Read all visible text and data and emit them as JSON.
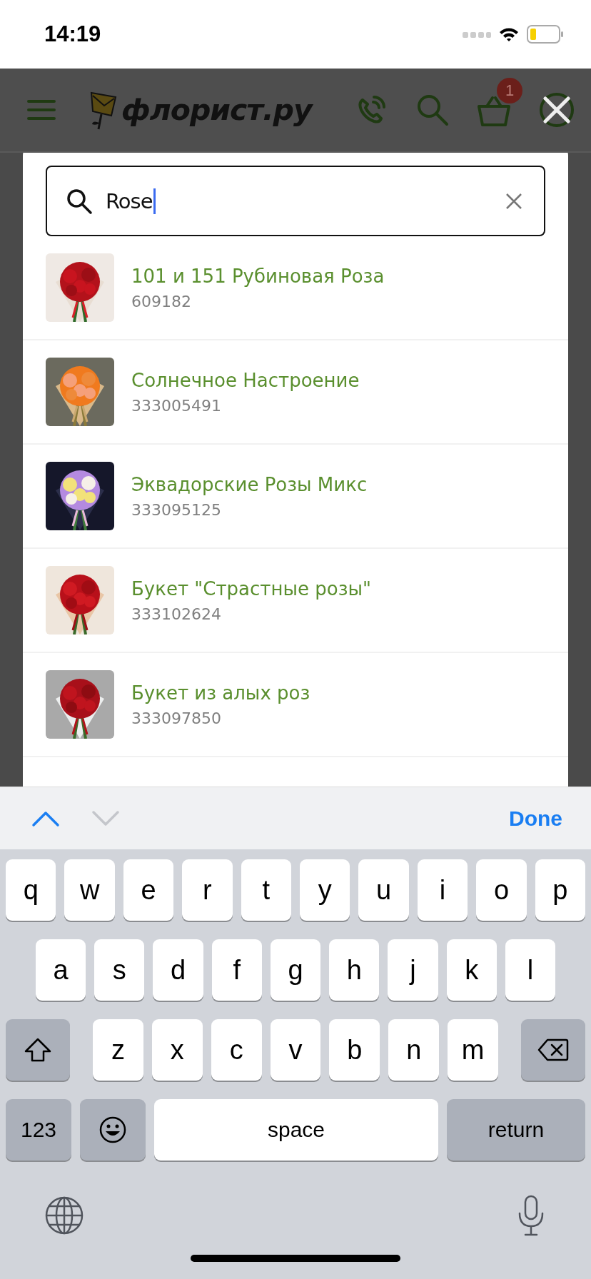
{
  "status_bar": {
    "time": "14:19"
  },
  "header": {
    "logo": "флорист.ру",
    "cart_badge": "1"
  },
  "search": {
    "value": "Rose"
  },
  "results": [
    {
      "title": "101 и 151 Рубиновая Роза",
      "code": "609182"
    },
    {
      "title": "Солнечное Настроение",
      "code": "333005491"
    },
    {
      "title": "Эквадорские Розы Микс",
      "code": "333095125"
    },
    {
      "title": "Букет \"Страстные розы\"",
      "code": "333102624"
    },
    {
      "title": "Букет из алых роз",
      "code": "333097850"
    }
  ],
  "keyboard_toolbar": {
    "nav": [
      {
        "kind": "up",
        "disabled": false
      },
      {
        "kind": "down",
        "disabled": true
      }
    ],
    "done": "Done"
  },
  "keyboard": {
    "letter_rows": [
      [
        {
          "kind": "letter",
          "label": "q"
        },
        {
          "kind": "letter",
          "label": "w"
        },
        {
          "kind": "letter",
          "label": "e"
        },
        {
          "kind": "letter",
          "label": "r"
        },
        {
          "kind": "letter",
          "label": "t"
        },
        {
          "kind": "letter",
          "label": "y"
        },
        {
          "kind": "letter",
          "label": "u"
        },
        {
          "kind": "letter",
          "label": "i"
        },
        {
          "kind": "letter",
          "label": "o"
        },
        {
          "kind": "letter",
          "label": "p"
        }
      ],
      [
        {
          "kind": "letter",
          "label": "a"
        },
        {
          "kind": "letter",
          "label": "s"
        },
        {
          "kind": "letter",
          "label": "d"
        },
        {
          "kind": "letter",
          "label": "f"
        },
        {
          "kind": "letter",
          "label": "g"
        },
        {
          "kind": "letter",
          "label": "h"
        },
        {
          "kind": "letter",
          "label": "j"
        },
        {
          "kind": "letter",
          "label": "k"
        },
        {
          "kind": "letter",
          "label": "l"
        }
      ],
      [
        {
          "kind": "shift",
          "on": false
        },
        {
          "kind": "letter",
          "label": "z"
        },
        {
          "kind": "letter",
          "label": "x"
        },
        {
          "kind": "letter",
          "label": "c"
        },
        {
          "kind": "letter",
          "label": "v"
        },
        {
          "kind": "letter",
          "label": "b"
        },
        {
          "kind": "letter",
          "label": "n"
        },
        {
          "kind": "letter",
          "label": "m"
        },
        {
          "kind": "delete"
        }
      ]
    ],
    "bottom_keys": [
      {
        "kind": "mode",
        "label": "123"
      },
      {
        "kind": "emoji"
      },
      {
        "kind": "space",
        "label": "space"
      },
      {
        "kind": "return",
        "label": "return"
      }
    ]
  }
}
